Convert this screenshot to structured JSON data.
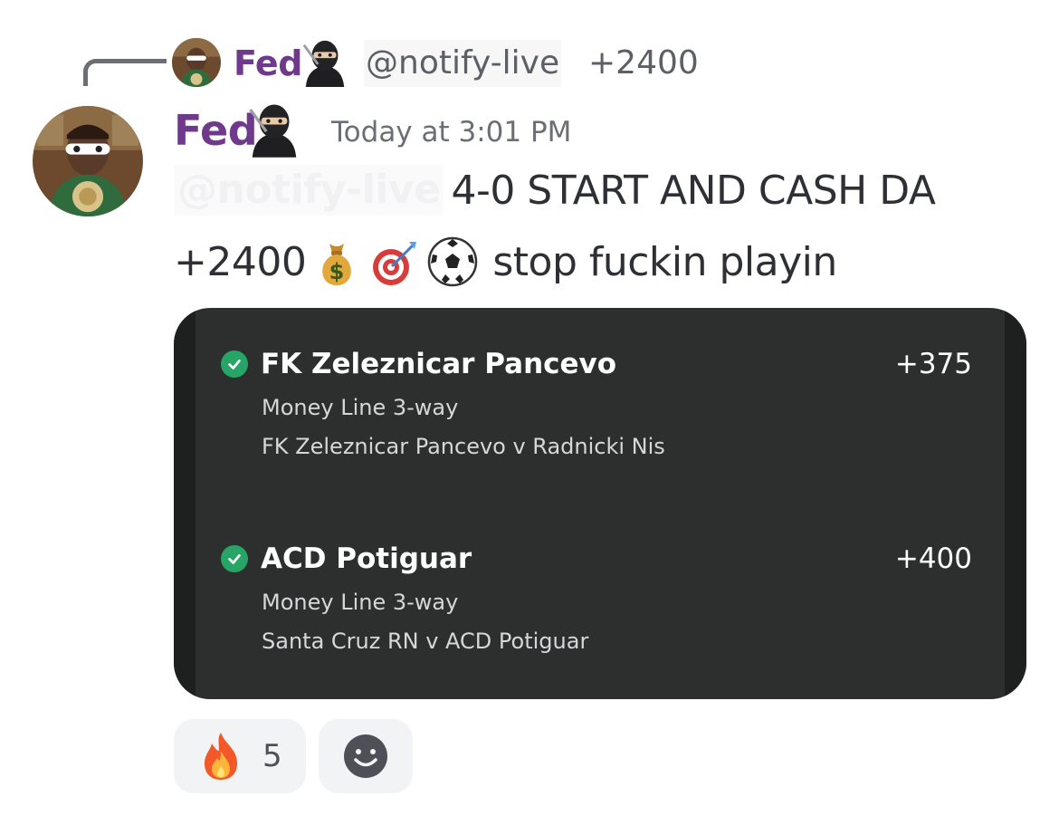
{
  "reply": {
    "author": "Fed",
    "author_badge_icon": "ninja-icon",
    "mention": "@notify-live",
    "text": "+2400"
  },
  "message": {
    "author": "Fed",
    "author_badge_icon": "ninja-icon",
    "timestamp": "Today at 3:01 PM",
    "mention": "@notify-live",
    "line1": "4-0 START AND CASH DA",
    "line2_start": "+2400",
    "emojis": [
      "money-bag-icon",
      "dart-target-icon",
      "soccer-ball-icon"
    ],
    "line2_end": "stop fuckin playin"
  },
  "bet_card": {
    "background": "#2c2f2e",
    "check_color": "#27a567",
    "legs": [
      {
        "team": "FK Zeleznicar Pancevo",
        "odds": "+375",
        "market": "Money Line 3-way",
        "match": "FK Zeleznicar Pancevo v Radnicki Nis"
      },
      {
        "team": "ACD Potiguar",
        "odds": "+400",
        "market": "Money Line 3-way",
        "match": "Santa Cruz RN v ACD Potiguar"
      }
    ]
  },
  "reactions": {
    "fire": {
      "icon": "fire-icon",
      "count": "5"
    },
    "add": {
      "icon": "add-reaction-icon"
    }
  },
  "colors": {
    "username": "#6f3a8c",
    "text": "#2e3035",
    "muted": "#6b6e75"
  }
}
